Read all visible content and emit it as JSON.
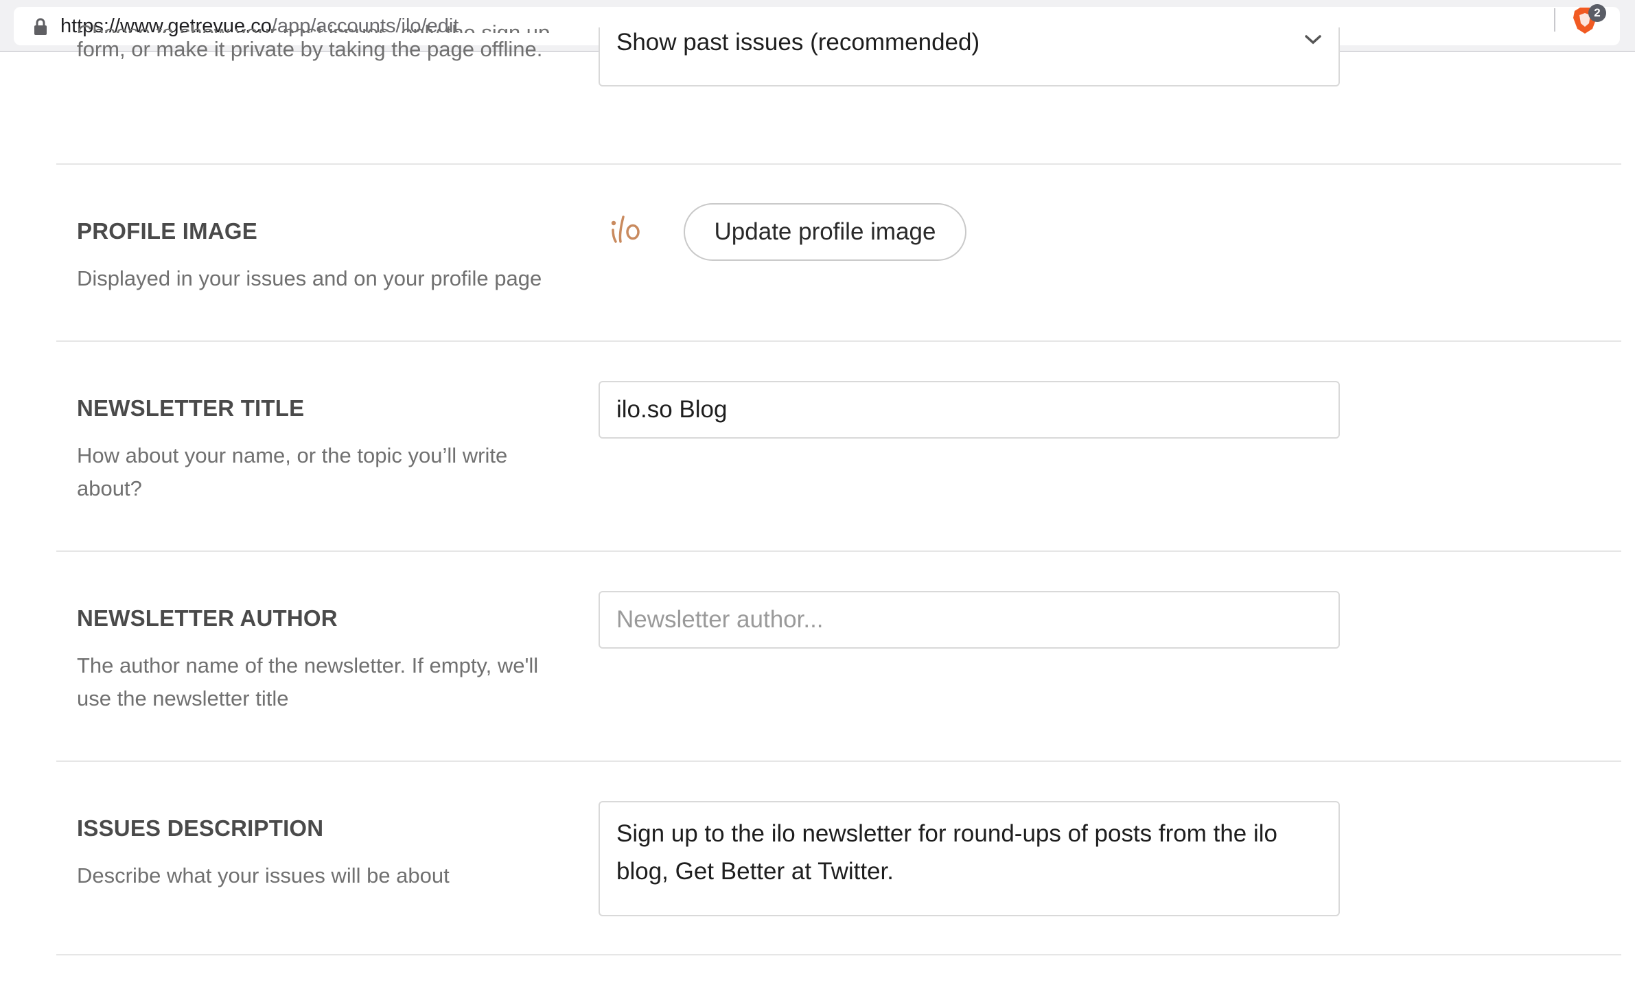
{
  "browser": {
    "url_host": "https://www.getrevue.co",
    "url_path": "/app/accounts/ilo/edit",
    "badge_count": "2"
  },
  "settings": {
    "visibility": {
      "desc_line1": "Choose to show your past issues, only the sign up",
      "desc_line2": "form, or make it private by taking the page offline.",
      "selected_value": "Show past issues (recommended)"
    },
    "profile_image": {
      "label": "PROFILE IMAGE",
      "desc": "Displayed in your issues and on your profile page",
      "logo_text": "ilo",
      "button_label": "Update profile image"
    },
    "newsletter_title": {
      "label": "NEWSLETTER TITLE",
      "desc": "How about your name, or the topic you’ll write about?",
      "value": "ilo.so Blog"
    },
    "newsletter_author": {
      "label": "NEWSLETTER AUTHOR",
      "desc": "The author name of the newsletter. If empty, we'll use the newsletter title",
      "value": "",
      "placeholder": "Newsletter author..."
    },
    "issues_description": {
      "label": "ISSUES DESCRIPTION",
      "desc": "Describe what your issues will be about",
      "value": "Sign up to the ilo newsletter for round-ups of posts from the ilo blog, Get Better at Twitter."
    }
  },
  "colors": {
    "brand_orange": "#c98a5e",
    "brave_orange": "#f15a22"
  }
}
